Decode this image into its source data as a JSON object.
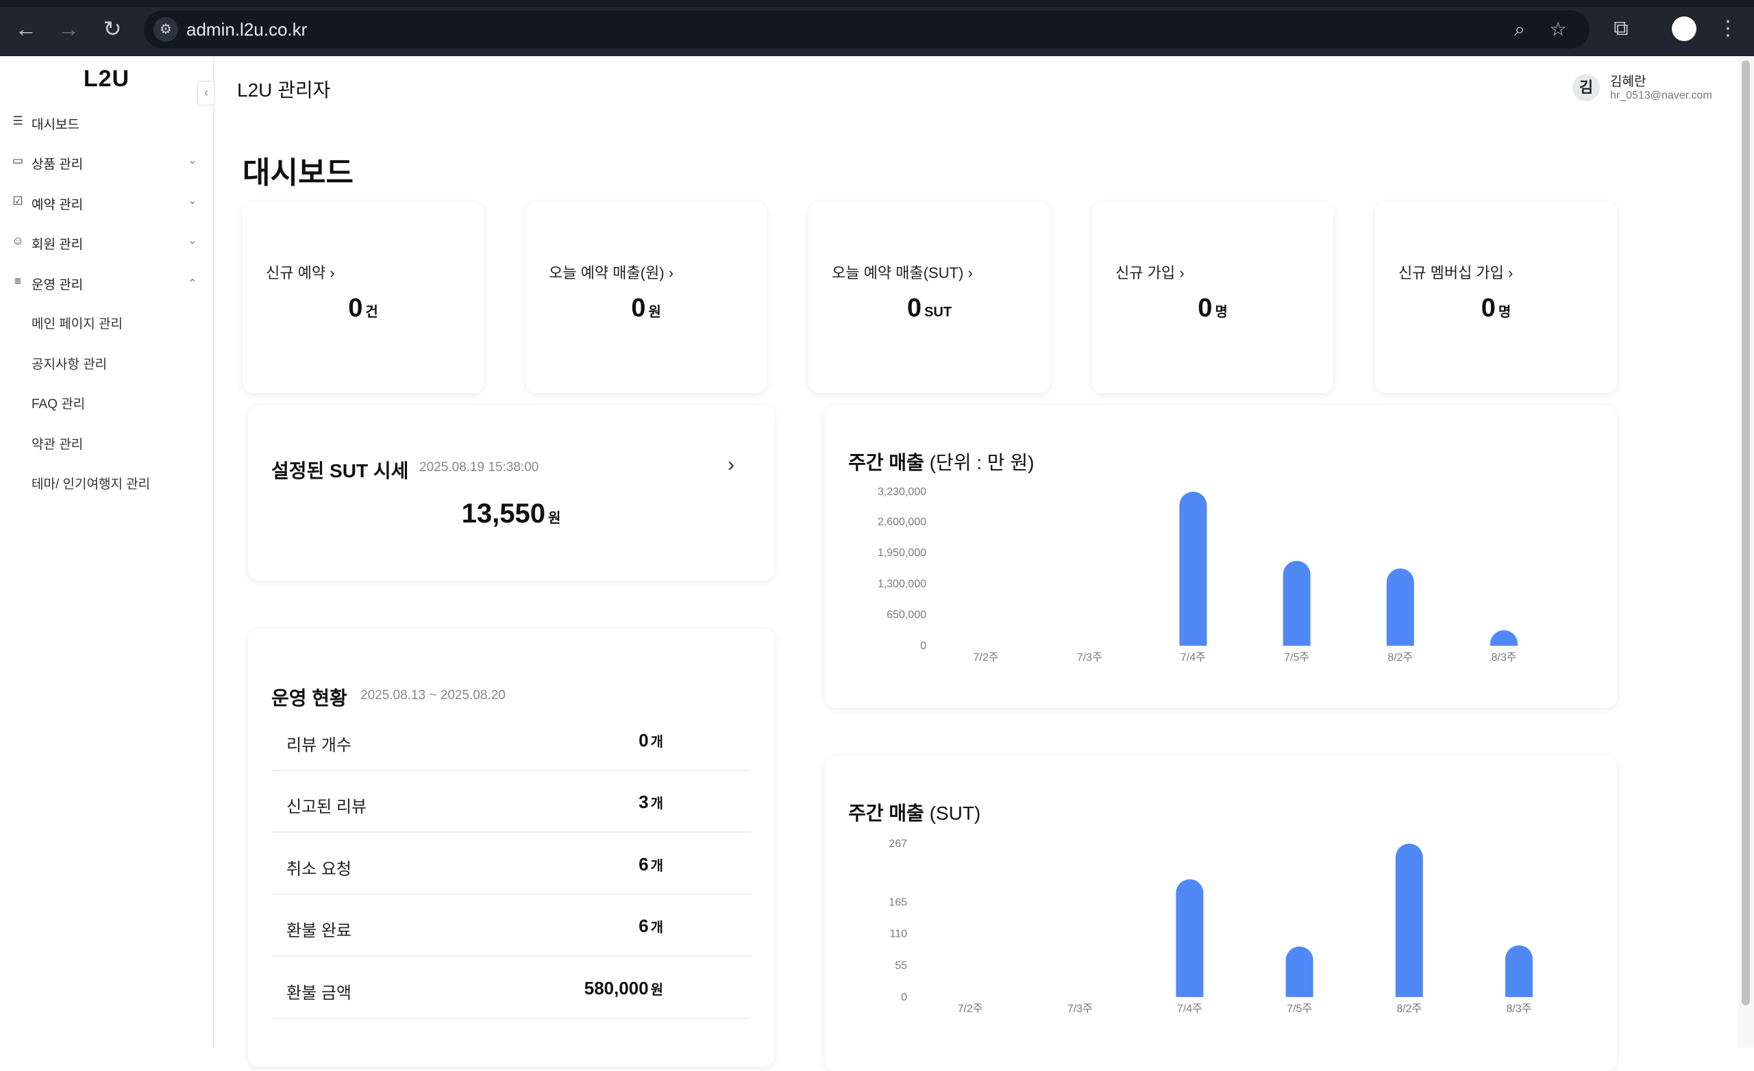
{
  "browser": {
    "url": "admin.l2u.co.kr"
  },
  "sidebar": {
    "logo": "L2U",
    "items": [
      {
        "label": "대시보드",
        "icon": "dashboard-icon",
        "chevron": ""
      },
      {
        "label": "상품 관리",
        "icon": "bag-icon",
        "chevron": "down"
      },
      {
        "label": "예약 관리",
        "icon": "calendar-check-icon",
        "chevron": "down"
      },
      {
        "label": "회원 관리",
        "icon": "users-icon",
        "chevron": "down"
      },
      {
        "label": "운영 관리",
        "icon": "list-settings-icon",
        "chevron": "up"
      }
    ],
    "sub_items": [
      "메인 페이지 관리",
      "공지사항 관리",
      "FAQ 관리",
      "약관 관리",
      "테마/ 인기여행지 관리"
    ]
  },
  "header": {
    "title": "L2U 관리자",
    "user": {
      "avatar": "김",
      "name": "김혜란",
      "email": "hr_0513@naver.com"
    }
  },
  "page": {
    "heading": "대시보드"
  },
  "stats": [
    {
      "label": "신규 예약",
      "value": "0",
      "unit": "건"
    },
    {
      "label": "오늘 예약 매출(원)",
      "value": "0",
      "unit": "원"
    },
    {
      "label": "오늘 예약 매출(SUT)",
      "value": "0",
      "unit": "SUT"
    },
    {
      "label": "신규 가입",
      "value": "0",
      "unit": "명"
    },
    {
      "label": "신규 멤버십 가입",
      "value": "0",
      "unit": "명"
    }
  ],
  "sut_price": {
    "title": "설정된 SUT 시세",
    "datetime": "2025.08.19 15:38:00",
    "value": "13,550",
    "unit": "원"
  },
  "operations": {
    "title": "운영 현황",
    "period": "2025.08.13 ~ 2025.08.20",
    "rows": [
      {
        "label": "리뷰 개수",
        "value": "0",
        "unit": "개"
      },
      {
        "label": "신고된 리뷰",
        "value": "3",
        "unit": "개"
      },
      {
        "label": "취소 요청",
        "value": "6",
        "unit": "개"
      },
      {
        "label": "환불 완료",
        "value": "6",
        "unit": "개"
      },
      {
        "label": "환불 금액",
        "value": "580,000",
        "unit": "원"
      }
    ]
  },
  "colors": {
    "bar": "#5089f5",
    "background": "#ffffff",
    "chrome": "#1f2630"
  },
  "chart_data": [
    {
      "type": "bar",
      "title_main": "주간 매출",
      "title_unit": "(단위 : 만 원)",
      "categories": [
        "7/2주",
        "7/3주",
        "7/4주",
        "7/5주",
        "8/2주",
        "8/3주"
      ],
      "values": [
        0,
        0,
        3230000,
        1780000,
        1620000,
        80000
      ],
      "yticks": [
        0,
        650000,
        1300000,
        1950000,
        2600000,
        3230000
      ],
      "ytick_labels": [
        "0",
        "650,000",
        "1,300,000",
        "1,950,000",
        "2,600,000",
        "3,230,000"
      ],
      "ylim": [
        0,
        3230000
      ],
      "grid": false
    },
    {
      "type": "bar",
      "title_main": "주간 매출",
      "title_unit": "(SUT)",
      "categories": [
        "7/2주",
        "7/3주",
        "7/4주",
        "7/5주",
        "8/2주",
        "8/3주"
      ],
      "values": [
        0,
        0,
        205,
        88,
        267,
        90
      ],
      "yticks": [
        0,
        55,
        110,
        165,
        267
      ],
      "ytick_labels": [
        "0",
        "55",
        "110",
        "165",
        "267"
      ],
      "ylim": [
        0,
        267
      ],
      "grid": false
    }
  ]
}
